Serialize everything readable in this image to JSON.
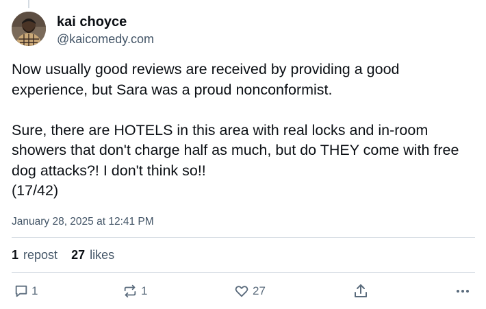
{
  "post": {
    "author": {
      "display_name": "kai choyce",
      "handle": "@kaicomedy.com"
    },
    "text": "Now usually good reviews are received by providing a good experience, but Sara was a proud nonconformist.\n\nSure, there are HOTELS in this area with real locks and in-room showers that don't charge half as much, but do THEY come with free dog attacks?! I don't think so!!\n(17/42)",
    "timestamp": "January 28, 2025 at 12:41 PM",
    "stats": {
      "reposts_count": "1",
      "reposts_label": "repost",
      "likes_count": "27",
      "likes_label": "likes"
    },
    "actions": {
      "reply_count": "1",
      "repost_count": "1",
      "like_count": "27"
    }
  },
  "icons": {
    "reply": "reply-icon",
    "repost": "repost-icon",
    "like": "heart-icon",
    "share": "share-icon",
    "more": "more-options-icon"
  },
  "colors": {
    "text_primary": "#0b0f14",
    "text_secondary": "#425466",
    "divider": "#d4dbe2"
  }
}
